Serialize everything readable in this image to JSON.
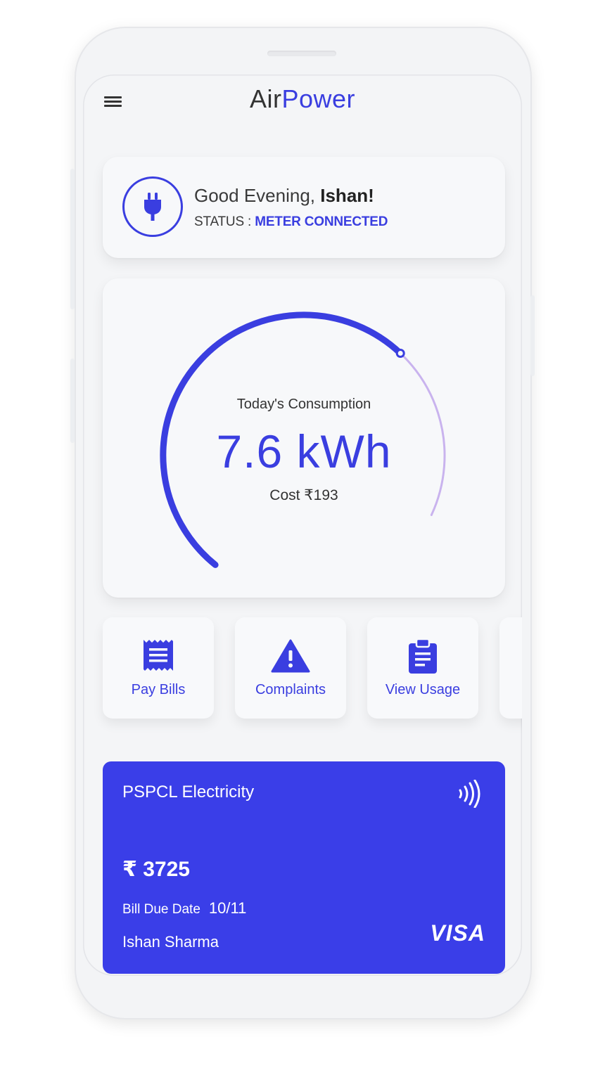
{
  "app": {
    "logo_part1": "Air",
    "logo_part2": "Power"
  },
  "status": {
    "greeting": "Good Evening,",
    "name": "Ishan!",
    "status_label": "STATUS :",
    "status_value": "METER CONNECTED"
  },
  "consumption": {
    "title": "Today's Consumption",
    "value": "7.6 kWh",
    "cost": "Cost ₹193",
    "gauge_fraction": 0.72
  },
  "actions": [
    {
      "label": "Pay Bills",
      "icon": "receipt-icon"
    },
    {
      "label": "Complaints",
      "icon": "warning-icon"
    },
    {
      "label": "View Usage",
      "icon": "clipboard-icon"
    }
  ],
  "bill": {
    "provider": "PSPCL Electricity",
    "amount": "₹ 3725",
    "due_label": "Bill Due Date",
    "due_value": "10/11",
    "holder": "Ishan Sharma",
    "network": "VISA"
  },
  "colors": {
    "accent": "#3a3ee0",
    "card_blue": "#3a3ee8",
    "gauge_track": "#c9b3ee"
  }
}
